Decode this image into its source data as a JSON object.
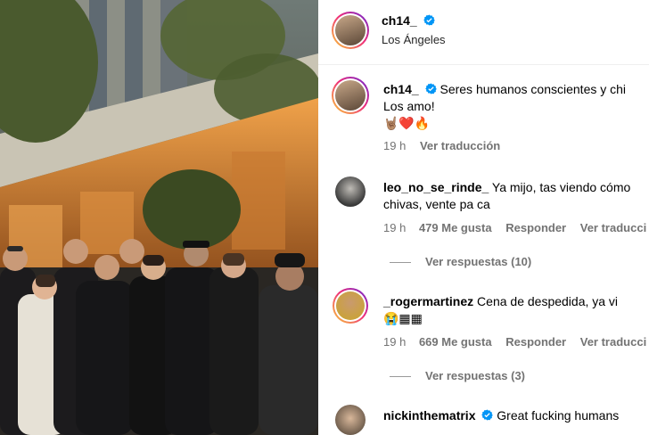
{
  "post": {
    "author": "ch14_",
    "location": "Los Ángeles",
    "caption": "Seres humanos conscientes y chi",
    "caption_line2": "Los amo!",
    "caption_emojis": "🤘🏽❤️🔥",
    "time": "19 h",
    "see_translation": "Ver traducción"
  },
  "comments": [
    {
      "user": "leo_no_se_rinde_",
      "text": "Ya mijo, tas viendo cómo",
      "text_line2": "chivas, vente pa ca",
      "time": "19 h",
      "likes": "479 Me gusta",
      "reply": "Responder",
      "translate": "Ver traducci",
      "view_replies": "Ver respuestas (10)"
    },
    {
      "user": "_rogermartinez",
      "text": "Cena de despedida, ya vi",
      "text_line2": "😭▦▦",
      "time": "19 h",
      "likes": "669 Me gusta",
      "reply": "Responder",
      "translate": "Ver traducci",
      "view_replies": "Ver respuestas (3)"
    },
    {
      "user": "nickinthematrix",
      "text": "Great fucking humans"
    }
  ],
  "colors": {
    "verified": "#0095f6",
    "secondary_text": "#737373",
    "story_ring": [
      "#f9ce34",
      "#ee2a7b",
      "#6228d7"
    ]
  }
}
